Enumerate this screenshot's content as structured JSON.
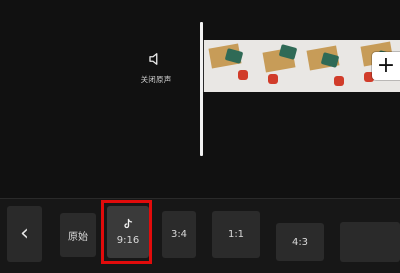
{
  "timeline": {
    "mute_label": "关闭原声"
  },
  "bottom_bar": {
    "back_glyph": "‹",
    "ratios": [
      {
        "label": "原始"
      },
      {
        "label": "9:16",
        "platform_icon": "tiktok-icon",
        "selected": true
      },
      {
        "label": "3:4"
      },
      {
        "label": "1:1"
      },
      {
        "label": "4:3"
      }
    ]
  },
  "add_button": {
    "glyph": "+"
  },
  "colors": {
    "highlight": "#e10b0b",
    "background": "#111111"
  }
}
